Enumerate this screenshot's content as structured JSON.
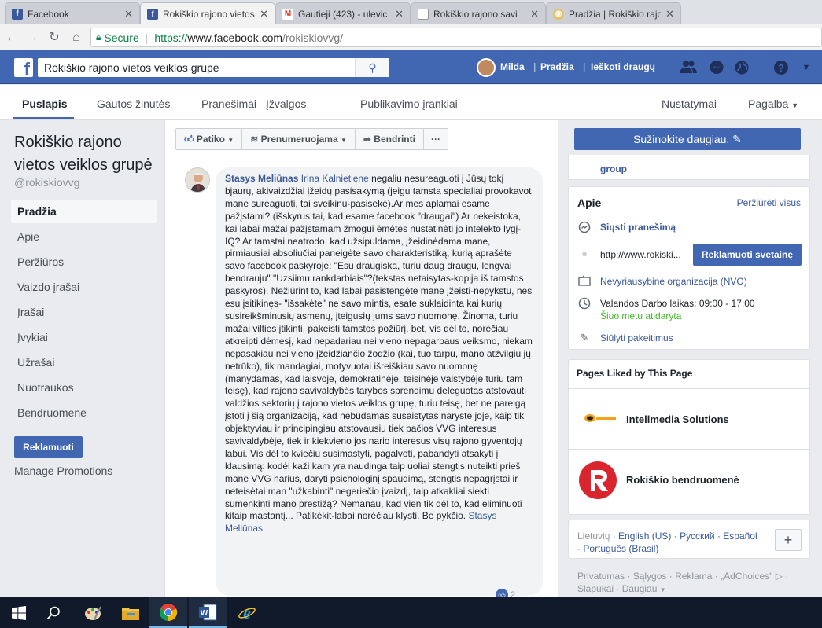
{
  "browser": {
    "tabs": [
      {
        "title": "Facebook",
        "favicon_color": "#3b5998",
        "favicon_char": "f",
        "active": false
      },
      {
        "title": "Rokiškio rajono vietos",
        "favicon_color": "#3b5998",
        "favicon_char": "f",
        "active": true
      },
      {
        "title": "Gautieji (423) - ulevic",
        "favicon_color": "#d93025",
        "favicon_char": "M",
        "active": false
      },
      {
        "title": "Rokiškio rajono savi",
        "favicon_color": "#9aa0a6",
        "favicon_char": "▯",
        "active": false
      },
      {
        "title": "Pradžia | Rokiškio rajo",
        "favicon_color": "#c8a030",
        "favicon_char": "◉",
        "active": false
      }
    ],
    "secure_label": "Secure",
    "url_scheme": "https://",
    "url_host": "www.facebook.com",
    "url_path": "/rokiskiovvg/"
  },
  "fb": {
    "search_value": "Rokiškio rajono vietos veiklos grupė",
    "user_name": "Milda",
    "nav_home": "Pradžia",
    "nav_find_friends": "Ieškoti draugų",
    "brand_color": "#4267b2"
  },
  "pagenav": {
    "items": [
      "Puslapis",
      "Gautos žinutės",
      "Pranešimai",
      "Įžvalgos",
      "Publikavimo įrankiai"
    ],
    "settings": "Nustatymai",
    "help": "Pagalba"
  },
  "left": {
    "title": "Rokiškio rajono vietos veiklos grupė",
    "handle": "@rokiskiovvg",
    "menu": [
      "Pradžia",
      "Apie",
      "Peržiūros",
      "Vaizdo įrašai",
      "Įrašai",
      "Įvykiai",
      "Užrašai",
      "Nuotraukos",
      "Bendruomenė"
    ],
    "promote_label": "Reklamuoti",
    "manage_label": "Manage Promotions"
  },
  "actions": {
    "like": "Patiko",
    "follow": "Prenumeruojama",
    "share": "Bendrinti",
    "more": "···"
  },
  "comment": {
    "author": "Stasys Meliūnas",
    "mention": "Irina Kalnietiene",
    "body": " negaliu nesureaguoti į Jūsų tokį bjaurų, akivaizdžiai įžeidų pasisakymą (jeigu tamsta specialiai provokavot mane sureaguoti, tai sveikinu-pasiseké).Ar mes aplamai esame pažįstami? (išskyrus tai, kad esame facebook \"draugai\") Ar nekeistoka, kai labai mažai pažįstamam žmogui ėmėtės nustatinėti jo intelekto lygį-IQ? Ar tamstai neatrodo, kad užsipuldama, įžeidinėdama mane, pirmiausiai absoliučiai paneigėte savo charakteristiką, kurią aprašėte savo facebook paskyroje: \"Esu draugiska, turiu daug draugu, lengvai bendrauju\" \"Uzsiimu rankdarbiais\"?(tekstas netaisytas-kopija iš tamstos paskyros). Nežiūrint to, kad labai pasistengėte mane įžeisti-nepykstu, nes esu įsitikinęs- \"išsakėte\" ne savo mintis, esate suklaidinta kai kurių susireikšminusių asmenų, įteigusių jums savo nuomonę. Žinoma, turiu mažai vilties įtikinti, pakeisti tamstos požiūrį, bet, vis dėl to, norėčiau atkreipti dėmesį, kad nepadariau nei vieno nepagarbaus veiksmo, niekam nepasakiau nei vieno įžeidžiančio žodžio (kai, tuo tarpu, mano atžvilgiu jų netrūko), tik mandagiai, motyvuotai išreiškiau savo nuomonę (manydamas, kad laisvoje, demokratinėje, teisinėje valstybėje turiu tam teisę), kad rajono savivaldybės tarybos sprendimu deleguotas atstovauti valdžios sektorių į rajono vietos veiklos grupę, turiu teisę, bet ne pareigą įstoti į šią organizaciją, kad nebūdamas susaistytas naryste joje, kaip tik objektyviau ir principingiau atstovausiu tiek pačios VVG interesus savivaldybėje, tiek ir kiekvieno jos nario interesus visų rajono gyventojų labui. Vis dėl to kviečiu susimastyti, pagalvoti, pabandyti atsakyti į klausimą: kodėl kaži kam yra naudinga taip uoliai stengtis nuteikti prieš mane VVG narius, daryti psichologinį spaudimą, stengtis nepagrįstai ir neteisėtai man \"užkabinti\" negeriečio įvaizdį, taip atkakliai siekti sumenkinti mano prestižą? Nemanau, kad vien tik dėl to, kad eliminuoti kitaip mastantį... Patikėkit-labai norėčiau klysti. Be pykčio. ",
    "signature": "Stasys Meliūnas",
    "like_count": "2"
  },
  "right": {
    "learn_more": "Sužinokite daugiau.",
    "stub_text": "group",
    "about_title": "Apie",
    "see_all": "Peržiūrėti visus",
    "send_message": "Siųsti pranešimą",
    "website": "http://www.rokiski...",
    "promote_site": "Reklamuoti svetainę",
    "category": "Nevyriausybinė organizacija (NVO)",
    "hours": "Valandos Darbo laikas: 09:00 - 17:00",
    "open_now": "Šiuo metu atidaryta",
    "suggest_edits": "Siūlyti pakeitimus",
    "liked_title": "Pages Liked by This Page",
    "liked_pages": [
      "Intellmedia Solutions",
      "Rokiškio bendruomenė"
    ],
    "lang_current": "Lietuvių",
    "lang_others": [
      "English (US)",
      "Русский",
      "Español",
      "Português (Brasil)"
    ],
    "footer_links": [
      "Privatumas",
      "Sąlygos",
      "Reklama",
      "„AdChoices\"",
      "Slapukai",
      "Daugiau"
    ]
  }
}
